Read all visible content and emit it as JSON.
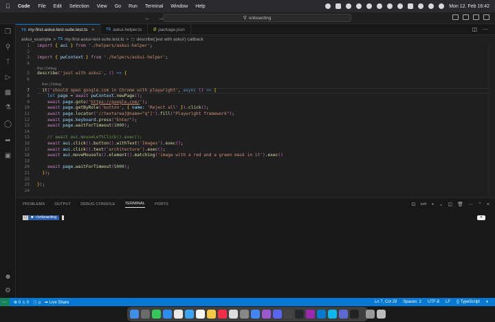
{
  "menubar": {
    "app": "Code",
    "items": [
      "File",
      "Edit",
      "Selection",
      "View",
      "Go",
      "Run",
      "Terminal",
      "Window",
      "Help"
    ],
    "clock": "Mon 12. Feb  16:42"
  },
  "titlebar": {
    "search": "onboarding"
  },
  "tabs": [
    {
      "label": "my-first-askui-test-suite.test.ts",
      "active": true,
      "icon": "TS"
    },
    {
      "label": "askui-helper.ts",
      "active": false,
      "icon": "TS"
    },
    {
      "label": "package.json",
      "active": false,
      "icon": "{}"
    }
  ],
  "breadcrumb": {
    "folder": "askui_example",
    "sep": ">",
    "file": "my-first-askui-test-suite.test.ts",
    "symbol": "describe('jest with askui') callback"
  },
  "editor": {
    "codelens_1": "Run | Debug",
    "codelens_2": "Run | Debug",
    "lines": [
      {
        "n": "1",
        "code": "import { aui } from './helpers/askui-helper';"
      },
      {
        "n": "2",
        "code": ""
      },
      {
        "n": "3",
        "code": "import { pwContext } from './helpers/askui-helper';"
      },
      {
        "n": "4",
        "code": ""
      },
      {
        "n": "5",
        "code": "describe('jest with askui', () => {"
      },
      {
        "n": "6",
        "code": ""
      },
      {
        "n": "7",
        "code": "  it('should open google.com in Chrome with playwright', async () => {"
      },
      {
        "n": "8",
        "code": "    let page = await pwContext.newPage();"
      },
      {
        "n": "9",
        "code": "    await page.goto('https://google.com/');"
      },
      {
        "n": "10",
        "code": "    await page.getByRole('button', { name: 'Reject all' }).click();"
      },
      {
        "n": "11",
        "code": "    await page.locator('//textarea[@name=\"q\"]').fill(\"Playwright framework\");"
      },
      {
        "n": "12",
        "code": "    await page.keyboard.press(\"Enter\");"
      },
      {
        "n": "13",
        "code": "    await page.waitForTimeout(1000);"
      },
      {
        "n": "14",
        "code": ""
      },
      {
        "n": "15",
        "code": "    // await aui.mouseLeftClick().exec();"
      },
      {
        "n": "16",
        "code": "    await aui.click().button().withText('Images').exec();"
      },
      {
        "n": "17",
        "code": "    await aui.click().text('architecture').exec();"
      },
      {
        "n": "18",
        "code": "    await aui.moveMouseTo().element().matching('image with a red and a green mask in it').exec()"
      },
      {
        "n": "19",
        "code": ""
      },
      {
        "n": "20",
        "code": "    await page.waitForTimeout(5000);"
      },
      {
        "n": "21",
        "code": "  });"
      },
      {
        "n": "22",
        "code": ""
      },
      {
        "n": "23",
        "code": "});"
      },
      {
        "n": "24",
        "code": ""
      }
    ]
  },
  "panel": {
    "tabs": [
      "PROBLEMS",
      "OUTPUT",
      "DEBUG CONSOLE",
      "TERMINAL",
      "PORTS"
    ],
    "active_tab": "TERMINAL",
    "shell": "zsh",
    "prompt_user": "",
    "prompt_path": "~/onboarding"
  },
  "statusbar": {
    "errors": "0",
    "warnings": "0",
    "info": "0",
    "live_share": "Live Share",
    "position": "Ln 7, Col 29",
    "spaces": "Spaces: 2",
    "encoding": "UTF-8",
    "eol": "LF",
    "language": "TypeScript"
  },
  "colors": {
    "accent": "#0078d4",
    "remote": "#16825d",
    "editor_bg": "#1f1f1f"
  }
}
